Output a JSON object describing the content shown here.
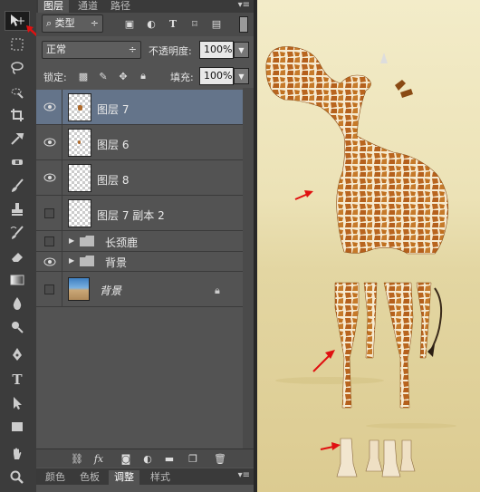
{
  "tabs": {
    "items": [
      {
        "label": "图层",
        "active": true
      },
      {
        "label": "通道",
        "active": false
      },
      {
        "label": "路径",
        "active": false
      }
    ]
  },
  "filter": {
    "kind_label": "类型",
    "search_icon": "search-icon"
  },
  "blend": {
    "mode": "正常",
    "opacity_label": "不透明度:",
    "opacity_value": "100%"
  },
  "lock": {
    "label": "锁定:",
    "fill_label": "填充:",
    "fill_value": "100%"
  },
  "layers": [
    {
      "name": "图层 7",
      "visible": true,
      "selected": true
    },
    {
      "name": "图层 6",
      "visible": true,
      "selected": false
    },
    {
      "name": "图层 8",
      "visible": true,
      "selected": false
    },
    {
      "name": "图层 7 副本 2",
      "visible": false,
      "selected": false
    },
    {
      "name": "长颈鹿",
      "visible": false,
      "group": true
    },
    {
      "name": "背景",
      "visible": true,
      "group": true
    },
    {
      "name": "背景",
      "visible": false,
      "locked": true
    }
  ],
  "bottom_tabs": {
    "items": [
      {
        "label": "颜色",
        "active": false
      },
      {
        "label": "色板",
        "active": false
      },
      {
        "label": "调整",
        "active": true
      },
      {
        "label": "样式",
        "active": false
      }
    ]
  },
  "colors": {
    "panel_bg": "#535353",
    "selected_layer": "#64748a",
    "annotation_arrow": "#e01010",
    "sand": "#e6d9a8"
  },
  "tools": [
    "move-tool",
    "marquee-tool",
    "lasso-tool",
    "quick-select-tool",
    "crop-tool",
    "eyedropper-tool",
    "healing-tool",
    "brush-tool",
    "clone-stamp-tool",
    "history-brush-tool",
    "eraser-tool",
    "gradient-tool",
    "blur-tool",
    "dodge-tool",
    "pen-tool",
    "type-tool",
    "path-select-tool",
    "rectangle-tool",
    "hand-tool",
    "zoom-tool"
  ]
}
